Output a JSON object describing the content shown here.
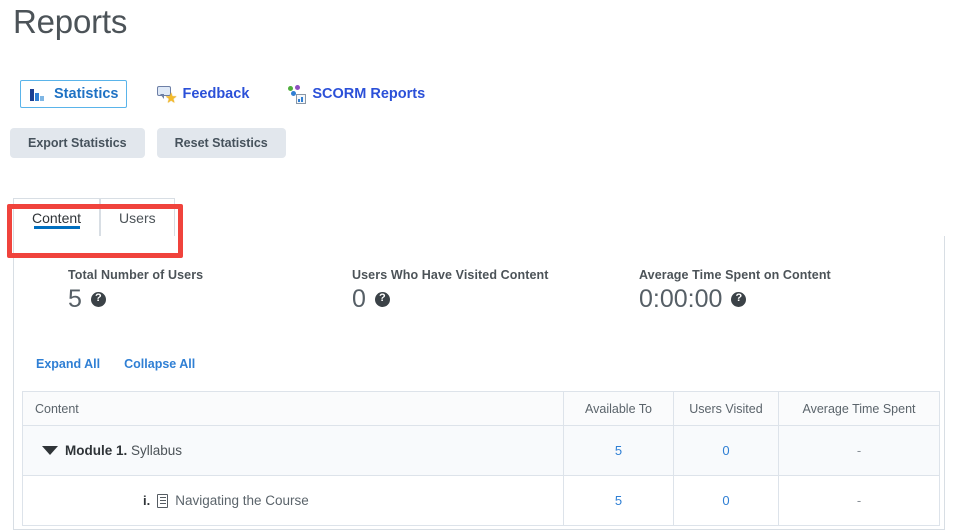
{
  "page": {
    "title": "Reports"
  },
  "tool_nav": {
    "items": [
      {
        "label": "Statistics",
        "icon": "bar-chart-icon",
        "active": true
      },
      {
        "label": "Feedback",
        "icon": "feedback-icon",
        "active": false
      },
      {
        "label": "SCORM Reports",
        "icon": "scorm-icon",
        "active": false
      }
    ]
  },
  "actions": {
    "export_label": "Export Statistics",
    "reset_label": "Reset Statistics"
  },
  "tabs": {
    "items": [
      {
        "label": "Content",
        "active": true
      },
      {
        "label": "Users",
        "active": false
      }
    ]
  },
  "stats": [
    {
      "label": "Total Number of Users",
      "value": "5",
      "help": "?"
    },
    {
      "label": "Users Who Have Visited Content",
      "value": "0",
      "help": "?"
    },
    {
      "label": "Average Time Spent on Content",
      "value": "0:00:00",
      "help": "?"
    }
  ],
  "tree_links": {
    "expand_all": "Expand All",
    "collapse_all": "Collapse All"
  },
  "table": {
    "headers": [
      "Content",
      "Available To",
      "Users Visited",
      "Average Time Spent"
    ],
    "rows": [
      {
        "type": "module",
        "prefix": "Module 1.",
        "title": "Syllabus",
        "available_to": "5",
        "users_visited": "0",
        "average_time_spent": "-"
      },
      {
        "type": "item",
        "numeral": "i.",
        "title": "Navigating the Course",
        "available_to": "5",
        "users_visited": "0",
        "average_time_spent": "-"
      }
    ]
  },
  "annotation": {
    "shape": "rectangle",
    "color": "#f0433c",
    "targets": "tabs"
  },
  "colors": {
    "link_blue": "#2f7fd4",
    "nav_blue": "#2b50d8",
    "tab_underline": "#006fbf",
    "annotation_red": "#f0433c",
    "button_bg": "#e2e7ed"
  }
}
